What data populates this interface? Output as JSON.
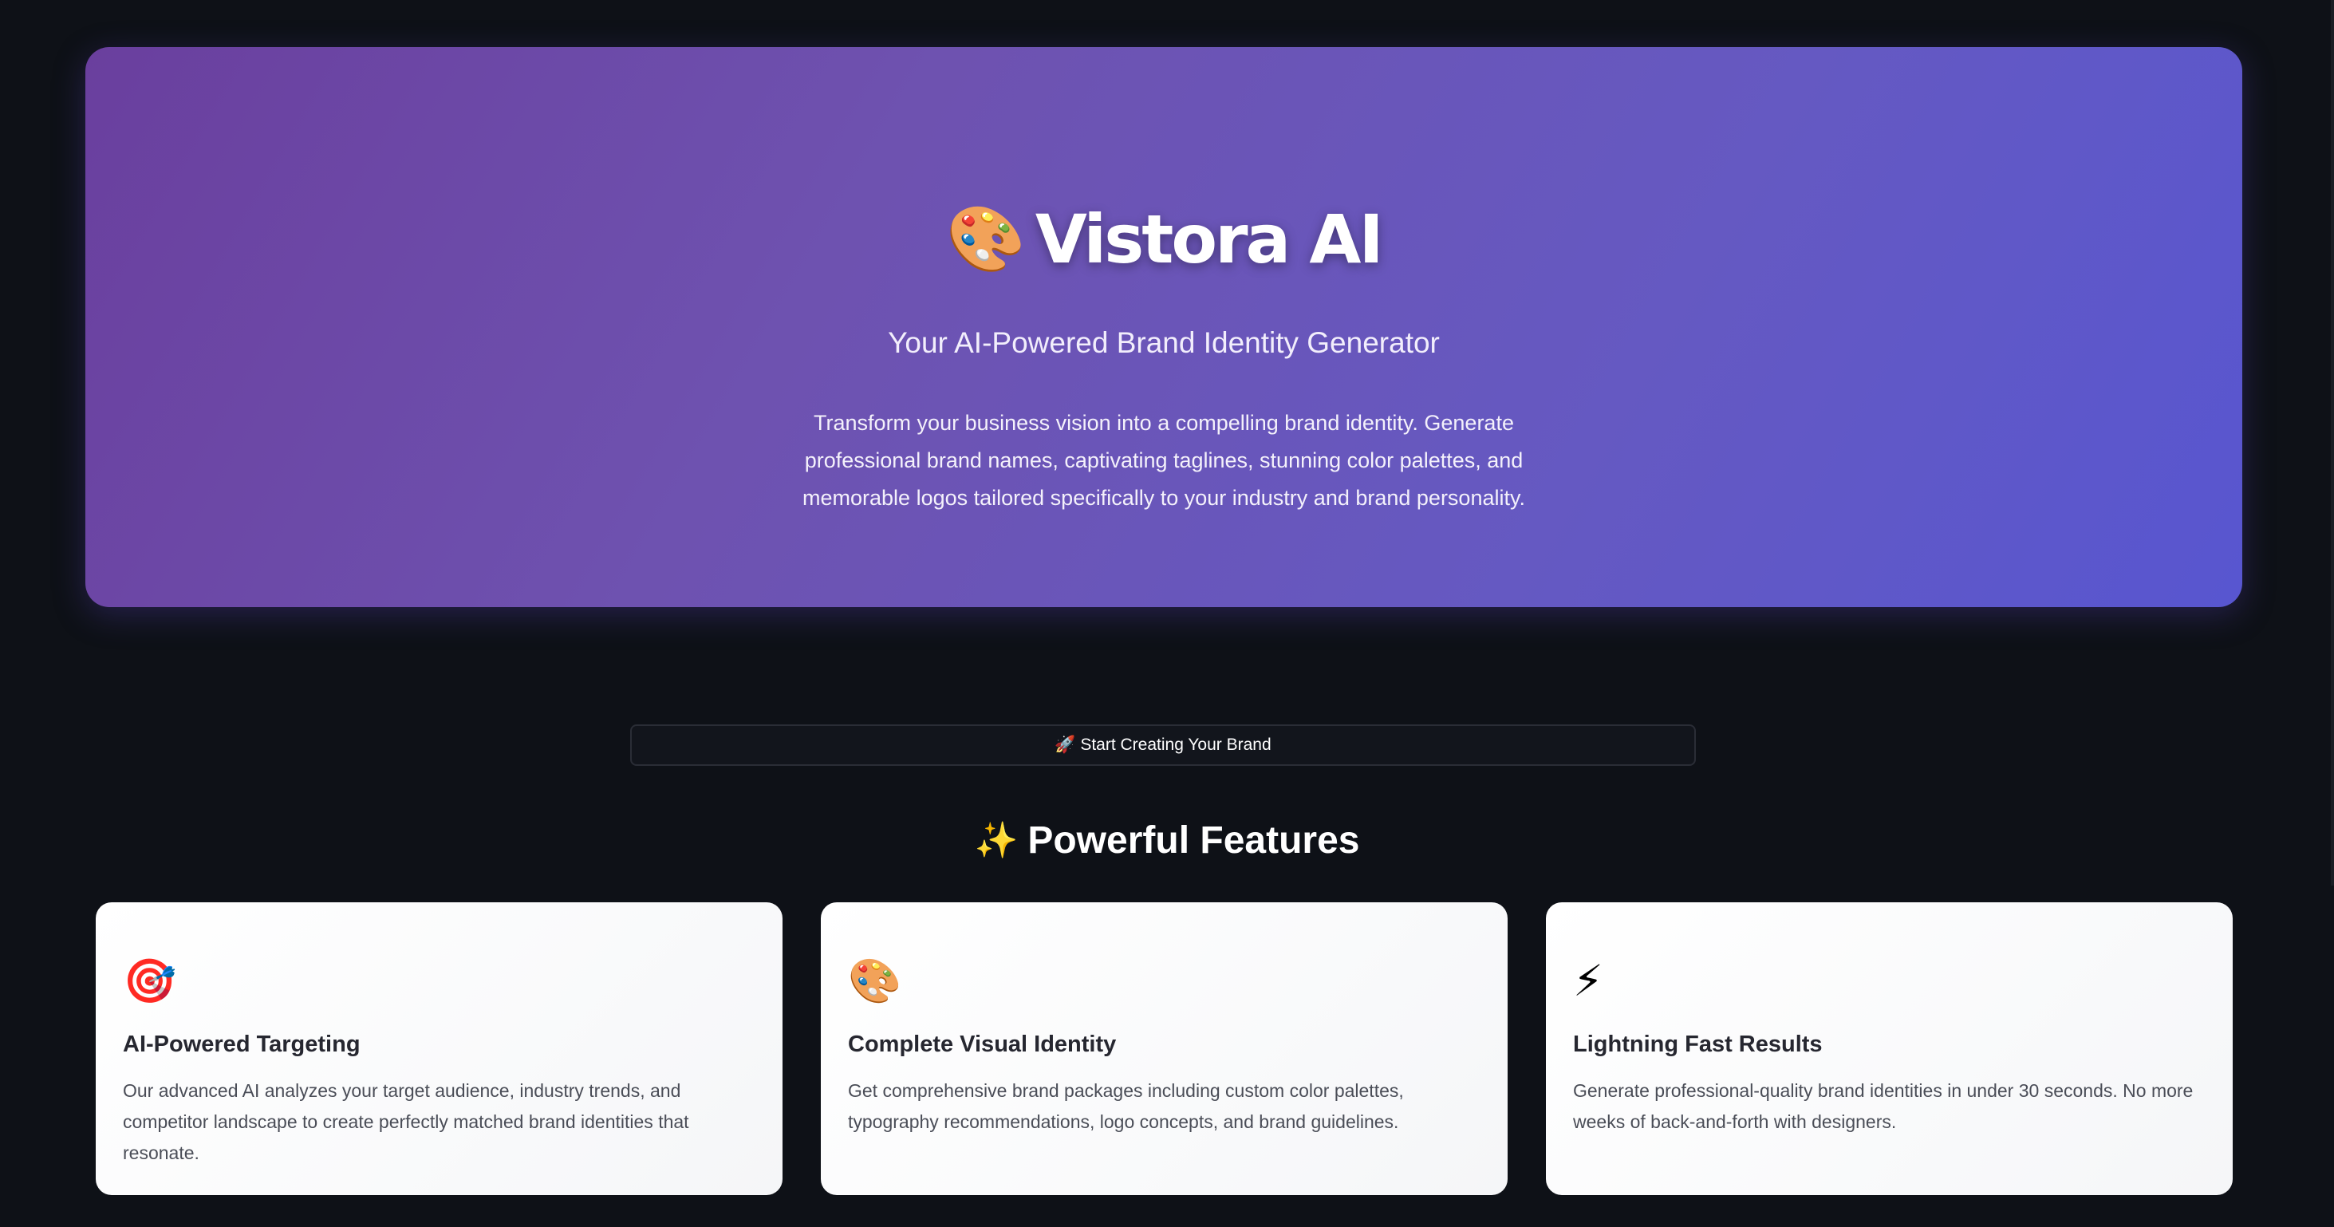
{
  "hero": {
    "title_icon": "artist-palette-emoji",
    "title_emoji": "🎨",
    "title": "Vistora AI",
    "subtitle": "Your AI-Powered Brand Identity Generator",
    "description": "Transform your business vision into a compelling brand identity. Generate professional brand names, captivating taglines, stunning color palettes, and memorable logos tailored specifically to your industry and brand personality."
  },
  "cta": {
    "icon": "rocket-emoji",
    "label": "🚀 Start Creating Your Brand"
  },
  "features": {
    "heading_icon": "sparkles-emoji",
    "heading_emoji": "✨",
    "heading": "Powerful Features",
    "cards": [
      {
        "icon": "direct-hit-target-emoji",
        "emoji": "🎯",
        "title": "AI-Powered Targeting",
        "text": "Our advanced AI analyzes your target audience, industry trends, and competitor landscape to create perfectly matched brand identities that resonate."
      },
      {
        "icon": "artist-palette-emoji",
        "emoji": "🎨",
        "title": "Complete Visual Identity",
        "text": "Get comprehensive brand packages including custom color palettes, typography recommendations, logo concepts, and brand guidelines."
      },
      {
        "icon": "lightning-bolt-emoji",
        "emoji": "⚡",
        "title": "Lightning Fast Results",
        "text": "Generate professional-quality brand identities in under 30 seconds. No more weeks of back-and-forth with designers."
      }
    ]
  },
  "colors": {
    "background": "#0e1117",
    "hero_gradient_start": "#6a3f9e",
    "hero_gradient_end": "#5856d0",
    "card_background": "#ffffff",
    "card_title": "#262730",
    "card_text": "#4a4d57"
  }
}
